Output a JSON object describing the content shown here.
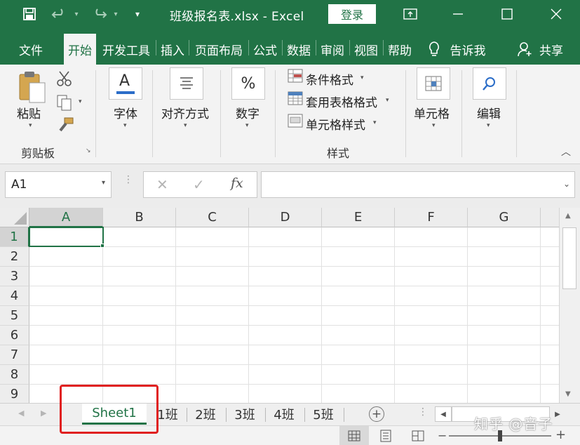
{
  "titlebar": {
    "title": "班级报名表.xlsx  -  Excel",
    "login_label": "登录",
    "icons": [
      "save-icon",
      "undo-icon",
      "redo-icon",
      "customize-qat-icon",
      "ribbon-display-icon",
      "minimize-icon",
      "maximize-icon",
      "close-icon"
    ]
  },
  "tabs": [
    {
      "label": "文件"
    },
    {
      "label": "开始"
    },
    {
      "label": "开发工具"
    },
    {
      "label": "插入"
    },
    {
      "label": "页面布局"
    },
    {
      "label": "公式"
    },
    {
      "label": "数据"
    },
    {
      "label": "审阅"
    },
    {
      "label": "视图"
    },
    {
      "label": "帮助"
    }
  ],
  "tell_me": "告诉我",
  "share": "共享",
  "ribbon": {
    "clipboard": {
      "paste": "粘贴",
      "group_label": "剪贴板"
    },
    "font": {
      "label": "字体",
      "icon_letter": "A"
    },
    "alignment": {
      "label": "对齐方式"
    },
    "number": {
      "label": "数字",
      "icon_symbol": "%"
    },
    "styles": {
      "conditional_format": "条件格式",
      "format_as_table": "套用表格格式",
      "cell_styles": "单元格样式",
      "group_label": "样式"
    },
    "cells": {
      "label": "单元格"
    },
    "editing": {
      "label": "编辑"
    }
  },
  "formula_bar": {
    "name_box": "A1",
    "cancel_glyph": "✕",
    "enter_glyph": "✓",
    "fx_label": "fx",
    "formula_value": ""
  },
  "grid": {
    "columns": [
      "A",
      "B",
      "C",
      "D",
      "E",
      "F",
      "G"
    ],
    "rows": [
      "1",
      "2",
      "3",
      "4",
      "5",
      "6",
      "7",
      "8",
      "9"
    ],
    "active_cell": "A1"
  },
  "sheets": [
    {
      "label": "Sheet1",
      "active": true
    },
    {
      "label": "1班"
    },
    {
      "label": "2班"
    },
    {
      "label": "3班"
    },
    {
      "label": "4班"
    },
    {
      "label": "5班"
    }
  ],
  "watermark": "知乎 @音子",
  "colors": {
    "accent": "#217346",
    "highlight": "#e02020"
  }
}
